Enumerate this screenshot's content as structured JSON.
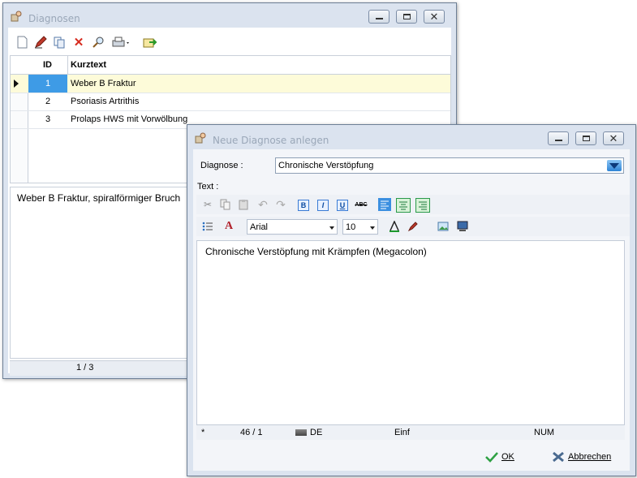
{
  "diagnosen_window": {
    "title": "Diagnosen",
    "grid": {
      "columns": [
        "ID",
        "Kurztext"
      ],
      "rows": [
        {
          "id": "1",
          "text": "Weber B Fraktur"
        },
        {
          "id": "2",
          "text": "Psoriasis Artrithis"
        },
        {
          "id": "3",
          "text": "Prolaps HWS mit Vorwölbung"
        }
      ]
    },
    "memo_text": "Weber B Fraktur, spiralförmiger Bruch",
    "status": "1 / 3"
  },
  "dialog": {
    "title": "Neue Diagnose anlegen",
    "diagnose_label": "Diagnose :",
    "diagnose_value": "Chronische Verstöpfung",
    "text_label": "Text :",
    "font_name": "Arial",
    "font_size": "10",
    "editor_text": "Chronische Verstöpfung mit Krämpfen (Megacolon)",
    "status": {
      "marker": "*",
      "position": "46 / 1",
      "language": "DE",
      "mode": "Einf",
      "num": "NUM"
    },
    "ok_label": "OK",
    "cancel_label": "Abbrechen"
  }
}
